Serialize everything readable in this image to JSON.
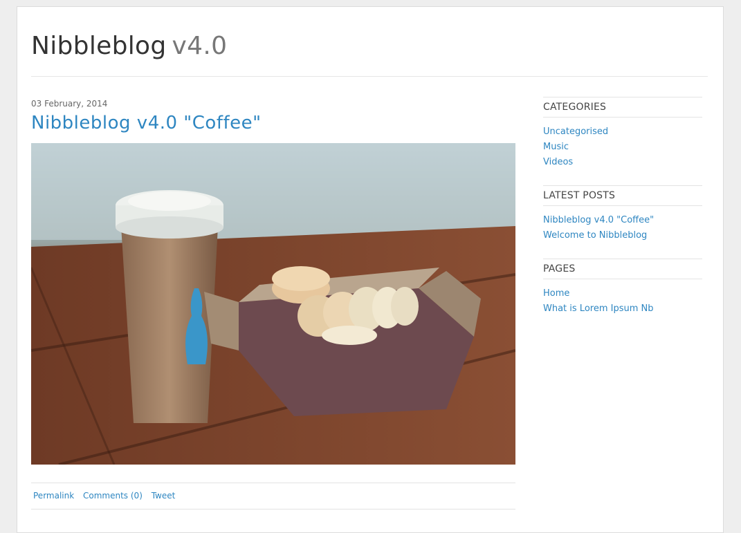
{
  "header": {
    "title": "Nibbleblog",
    "slogan": "v4.0"
  },
  "post": {
    "date": "03 February, 2014",
    "title": "Nibbleblog v4.0 \"Coffee\"",
    "footer": {
      "permalink": "Permalink",
      "comments": "Comments (0)",
      "tweet": "Tweet"
    }
  },
  "sidebar": {
    "categories": {
      "title": "CATEGORIES",
      "items": [
        "Uncategorised",
        "Music",
        "Videos"
      ]
    },
    "latest_posts": {
      "title": "LATEST POSTS",
      "items": [
        "Nibbleblog v4.0 \"Coffee\"",
        "Welcome to Nibbleblog"
      ]
    },
    "pages": {
      "title": "PAGES",
      "items": [
        "Home",
        "What is Lorem Ipsum Nb"
      ]
    }
  },
  "colors": {
    "link": "#2e86c1",
    "background": "#eeeeee"
  }
}
